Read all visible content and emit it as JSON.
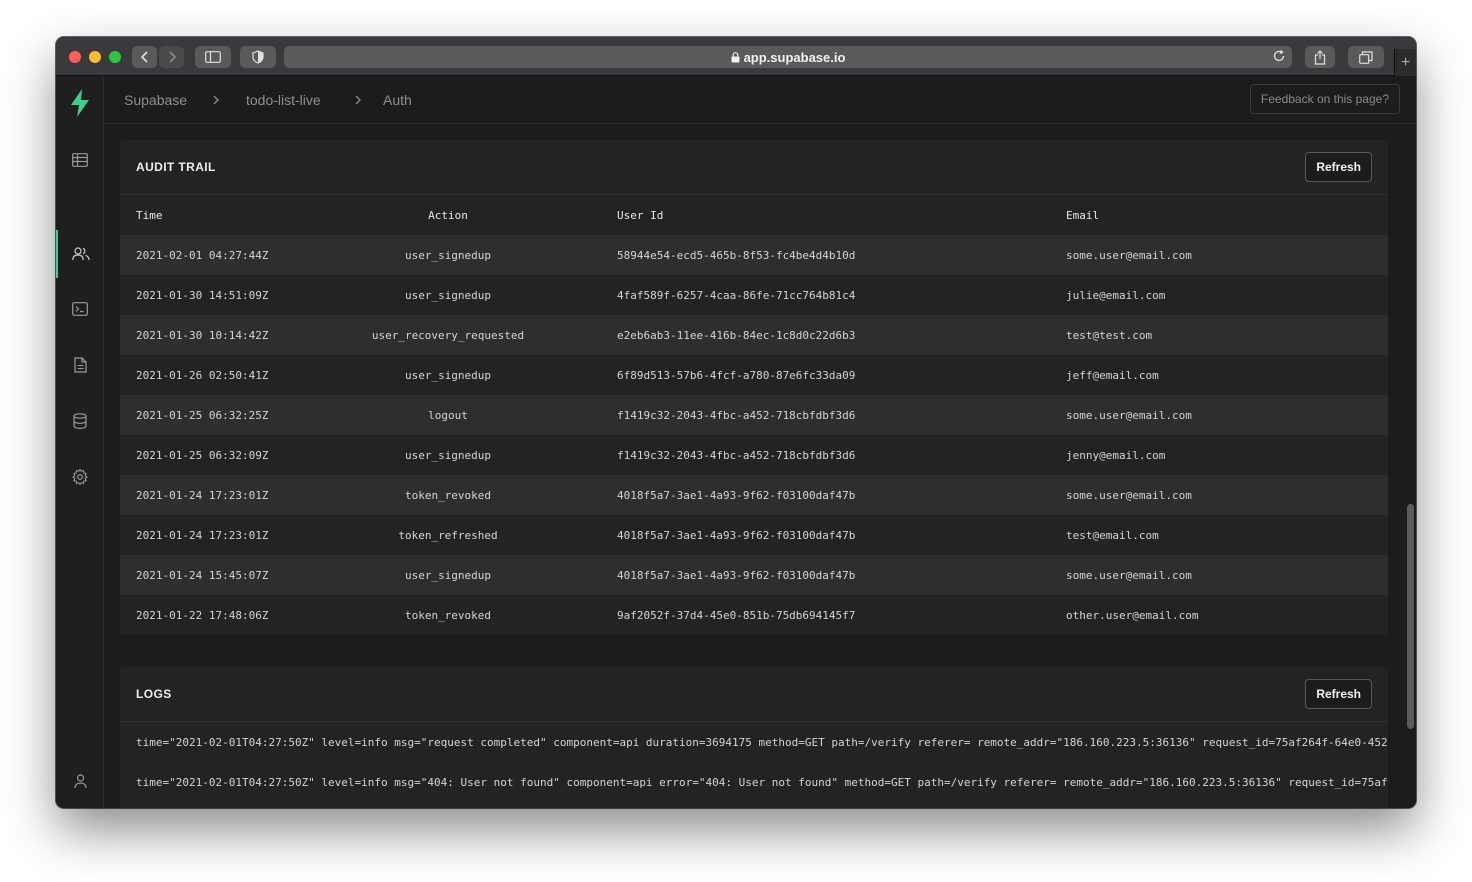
{
  "browser": {
    "url": "app.supabase.io",
    "new_tab_glyph": "+"
  },
  "breadcrumb": [
    "Supabase",
    "todo-list-live",
    "Auth"
  ],
  "header": {
    "feedback_label": "Feedback on this page?"
  },
  "sidebar": {
    "logo_icon": "supabase-bolt-icon",
    "items": [
      {
        "icon": "table-icon"
      },
      {
        "icon": "users-icon",
        "active": true
      },
      {
        "icon": "terminal-icon"
      },
      {
        "icon": "document-icon"
      },
      {
        "icon": "database-icon"
      },
      {
        "icon": "gear-icon"
      }
    ],
    "bottom_icon": "user-icon"
  },
  "audit": {
    "title": "AUDIT TRAIL",
    "refresh_label": "Refresh",
    "columns": [
      "Time",
      "Action",
      "User Id",
      "Email"
    ],
    "rows": [
      [
        "2021-02-01 04:27:44Z",
        "user_signedup",
        "58944e54-ecd5-465b-8f53-fc4be4d4b10d",
        "some.user@email.com"
      ],
      [
        "2021-01-30 14:51:09Z",
        "user_signedup",
        "4faf589f-6257-4caa-86fe-71cc764b81c4",
        "julie@email.com"
      ],
      [
        "2021-01-30 10:14:42Z",
        "user_recovery_requested",
        "e2eb6ab3-11ee-416b-84ec-1c8d0c22d6b3",
        "test@test.com"
      ],
      [
        "2021-01-26 02:50:41Z",
        "user_signedup",
        "6f89d513-57b6-4fcf-a780-87e6fc33da09",
        "jeff@email.com"
      ],
      [
        "2021-01-25 06:32:25Z",
        "logout",
        "f1419c32-2043-4fbc-a452-718cbfdbf3d6",
        "some.user@email.com"
      ],
      [
        "2021-01-25 06:32:09Z",
        "user_signedup",
        "f1419c32-2043-4fbc-a452-718cbfdbf3d6",
        "jenny@email.com"
      ],
      [
        "2021-01-24 17:23:01Z",
        "token_revoked",
        "4018f5a7-3ae1-4a93-9f62-f03100daf47b",
        "some.user@email.com"
      ],
      [
        "2021-01-24 17:23:01Z",
        "token_refreshed",
        "4018f5a7-3ae1-4a93-9f62-f03100daf47b",
        "test@email.com"
      ],
      [
        "2021-01-24 15:45:07Z",
        "user_signedup",
        "4018f5a7-3ae1-4a93-9f62-f03100daf47b",
        "some.user@email.com"
      ],
      [
        "2021-01-22 17:48:06Z",
        "token_revoked",
        "9af2052f-37d4-45e0-851b-75db694145f7",
        "other.user@email.com"
      ]
    ]
  },
  "logs": {
    "title": "LOGS",
    "refresh_label": "Refresh",
    "lines": [
      "time=\"2021-02-01T04:27:50Z\" level=info msg=\"request completed\" component=api duration=3694175 method=GET path=/verify referer= remote_addr=\"186.160.223.5:36136\" request_id=75af264f-64e0-452",
      "time=\"2021-02-01T04:27:50Z\" level=info msg=\"404: User not found\" component=api error=\"404: User not found\" method=GET path=/verify referer= remote_addr=\"186.160.223.5:36136\" request_id=75af"
    ]
  }
}
